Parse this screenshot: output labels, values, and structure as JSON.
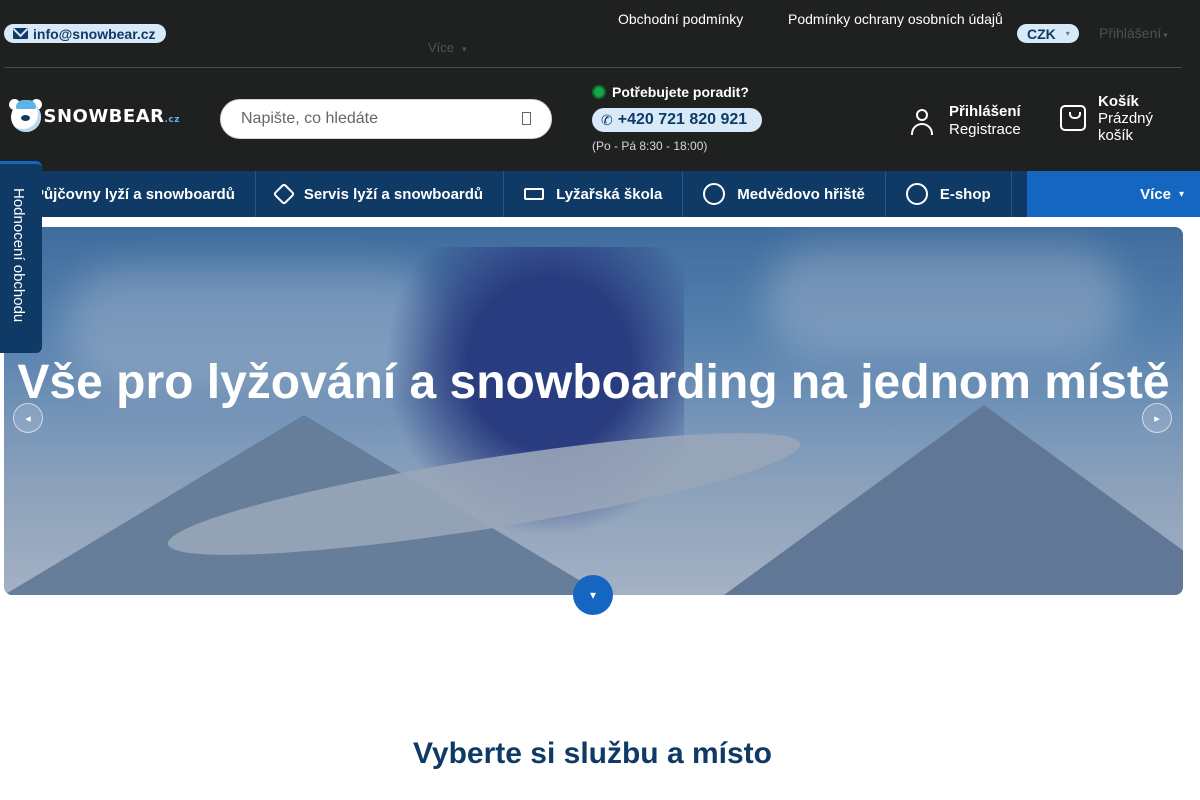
{
  "topbar": {
    "email": "info@snowbear.cz",
    "links": [
      "Obchodní podmínky",
      "Podmínky ochrany osobních údajů"
    ],
    "more_label": "Více",
    "currency": "CZK",
    "login_label": "Přihlášení"
  },
  "header": {
    "logo_text": "SNOWBEAR",
    "logo_suffix": ".cz",
    "search_placeholder": "Napište, co hledáte",
    "help_title": "Potřebujete poradit?",
    "phone": "+420 721 820 921",
    "hours": "(Po - Pá 8:30 - 18:00)",
    "account_login": "Přihlášení",
    "account_register": "Registrace",
    "cart_title": "Košík",
    "cart_status": "Prázdný košík"
  },
  "nav": {
    "items": [
      {
        "label": "Půjčovny lyží a snowboardů",
        "icon": "rental-icon"
      },
      {
        "label": "Servis lyží a snowboardů",
        "icon": "ski-service-icon"
      },
      {
        "label": "Lyžařská škola",
        "icon": "graduation-cap-icon"
      },
      {
        "label": "Medvědovo hřiště",
        "icon": "bear-face-icon"
      },
      {
        "label": "E-shop",
        "icon": "helmet-icon"
      }
    ],
    "more_label": "Více"
  },
  "hero": {
    "title": "Vše pro lyžování a snowboarding na jednom místě"
  },
  "side_tab": {
    "label": "Hodnocení obchodu"
  },
  "section": {
    "title": "Vyberte si službu a místo"
  },
  "colors": {
    "topbar_bg": "#1f2120",
    "nav_bg": "#0f3a66",
    "accent": "#1566c0",
    "pill_bg": "#d8eaf7",
    "status_green": "#1aa34a"
  }
}
